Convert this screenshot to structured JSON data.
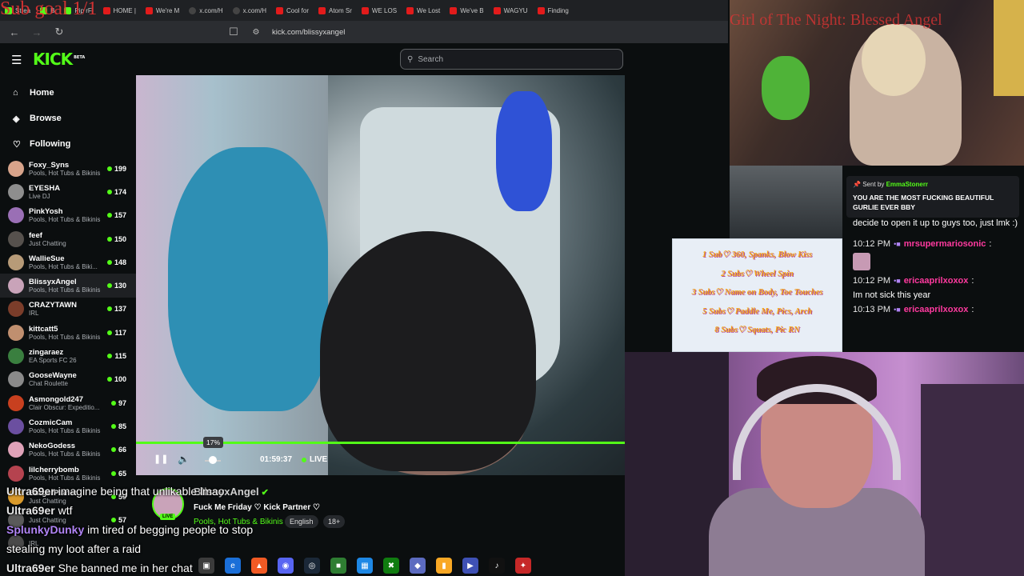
{
  "browser": {
    "tabs": [
      {
        "label": "Strea",
        "kind": "kick"
      },
      {
        "label": "B",
        "kind": "kick"
      },
      {
        "label": "Pip rFi",
        "kind": "kick"
      },
      {
        "label": "HOME |",
        "kind": "yt"
      },
      {
        "label": "We're M",
        "kind": "yt"
      },
      {
        "label": "x.com/H",
        "kind": "x"
      },
      {
        "label": "x.com/H",
        "kind": "x"
      },
      {
        "label": "Cool for",
        "kind": "yt"
      },
      {
        "label": "Atom Sr",
        "kind": "yt"
      },
      {
        "label": "WE LOS",
        "kind": "yt"
      },
      {
        "label": "We Lost",
        "kind": "yt"
      },
      {
        "label": "We've B",
        "kind": "yt"
      },
      {
        "label": "WAGYU",
        "kind": "yt"
      },
      {
        "label": "Finding",
        "kind": "yt"
      }
    ],
    "url": "kick.com/blissyxangel"
  },
  "overlays": {
    "sub_goal": "Sub goal 1/1",
    "cam_title": "Girl of The Night: Blessed Angel"
  },
  "header": {
    "logo": "KICK",
    "logo_badge": "BETA",
    "search_placeholder": "Search"
  },
  "sidebar": {
    "nav": [
      {
        "label": "Home",
        "icon": "home-icon"
      },
      {
        "label": "Browse",
        "icon": "compass-icon"
      },
      {
        "label": "Following",
        "icon": "heart-icon"
      }
    ],
    "channels": [
      {
        "name": "Foxy_Syns",
        "category": "Pools, Hot Tubs & Bikinis",
        "viewers": "199",
        "color": "#d8a48b"
      },
      {
        "name": "EYESHA",
        "category": "Live DJ",
        "viewers": "174",
        "color": "#8e8e8e"
      },
      {
        "name": "PinkYosh",
        "category": "Pools, Hot Tubs & Bikinis",
        "viewers": "157",
        "color": "#9a6fb5"
      },
      {
        "name": "feef",
        "category": "Just Chatting",
        "viewers": "150",
        "color": "#56514d"
      },
      {
        "name": "WallieSue",
        "category": "Pools, Hot Tubs & Biki...",
        "viewers": "148",
        "color": "#b79b78"
      },
      {
        "name": "BlissyxAngel",
        "category": "Pools, Hot Tubs & Bikinis",
        "viewers": "130",
        "color": "#c9a3b9",
        "active": true
      },
      {
        "name": "CRAZYTAWN",
        "category": "IRL",
        "viewers": "137",
        "color": "#7b3d2a"
      },
      {
        "name": "kittcatt5",
        "category": "Pools, Hot Tubs & Bikinis",
        "viewers": "117",
        "color": "#c08f6f"
      },
      {
        "name": "zingaraez",
        "category": "EA Sports FC 26",
        "viewers": "115",
        "color": "#3a7f3f"
      },
      {
        "name": "GooseWayne",
        "category": "Chat Roulette",
        "viewers": "100",
        "color": "#8a8a8a"
      },
      {
        "name": "Asmongold247",
        "category": "Clair Obscur: Expeditio...",
        "viewers": "97",
        "color": "#c8401f"
      },
      {
        "name": "CozmicCam",
        "category": "Pools, Hot Tubs & Bikinis",
        "viewers": "85",
        "color": "#6b4fa0"
      },
      {
        "name": "NekoGodess",
        "category": "Pools, Hot Tubs & Bikinis",
        "viewers": "66",
        "color": "#e0a2b8"
      },
      {
        "name": "lilcherrybomb",
        "category": "Pools, Hot Tubs & Bikinis",
        "viewers": "65",
        "color": "#b5434f"
      },
      {
        "name": "BurgerPlanet",
        "category": "Just Chatting",
        "viewers": "59",
        "color": "#d99a2b"
      },
      {
        "name": "",
        "category": "Just Chatting",
        "viewers": "57",
        "color": "#5a5a5a"
      },
      {
        "name": "",
        "category": "IRL",
        "viewers": "",
        "color": "#4a4a4a"
      }
    ]
  },
  "player": {
    "volume_percent": "17%",
    "volume_level": 0.17,
    "elapsed": "01:59:37",
    "live_label": "LIVE"
  },
  "stream_info": {
    "streamer": "BlissyxAngel",
    "title": "Fuck Me Friday ♡ Kick Partner ♡",
    "category": "Pools, Hot Tubs & Bikinis",
    "tags": [
      "English",
      "18+"
    ],
    "avatar_live": "LIVE"
  },
  "overlay_chat": [
    {
      "user": "Ultra69er",
      "text": "imagine being that unlikable lmao",
      "purple": false
    },
    {
      "user": "Ultra69er",
      "text": "wtf",
      "purple": false
    },
    {
      "user": "SplunkyDunky",
      "text": "im tired of begging people to stop",
      "purple": true
    },
    {
      "user": "",
      "text": "stealing my loot after a raid",
      "purple": false
    },
    {
      "user": "Ultra69er",
      "text": "She banned me in her chat",
      "purple": false
    }
  ],
  "chat": {
    "pinned": {
      "sent_by": "Sent by",
      "sender": "EmmaStonerr",
      "message": "YOU ARE THE MOST FUCKING BEAUTIFUL GURLIE EVER BBY"
    },
    "messages": [
      {
        "time": "",
        "user": "",
        "text": "decide to open it up to guys too, just lmk :)"
      },
      {
        "time": "10:12 PM",
        "user": "mrsupermariosonic",
        "text": ""
      },
      {
        "time": "10:12 PM",
        "user": "ericaaprilxoxox",
        "text": "Im not sick this year"
      },
      {
        "time": "10:13 PM",
        "user": "ericaaprilxoxox",
        "text": ""
      }
    ]
  },
  "promo": {
    "lines": [
      "1 Sub♡ 360, Spanks, Blow Kiss",
      "2 Subs♡ Wheel Spin",
      "3 Subs♡ Name on Body, Toe Touches",
      "5 Subs♡ Paddle Me, Pics, Arch",
      "8 Subs♡ Squats, Pic RN"
    ]
  },
  "taskbar": {
    "icons": [
      "file-explorer-icon",
      "edge-icon",
      "brave-icon",
      "discord-icon",
      "steam-icon",
      "app-icon",
      "store-icon",
      "xbox-icon",
      "vpn-icon",
      "chart-icon",
      "video-icon",
      "tiktok-icon",
      "app2-icon"
    ]
  }
}
